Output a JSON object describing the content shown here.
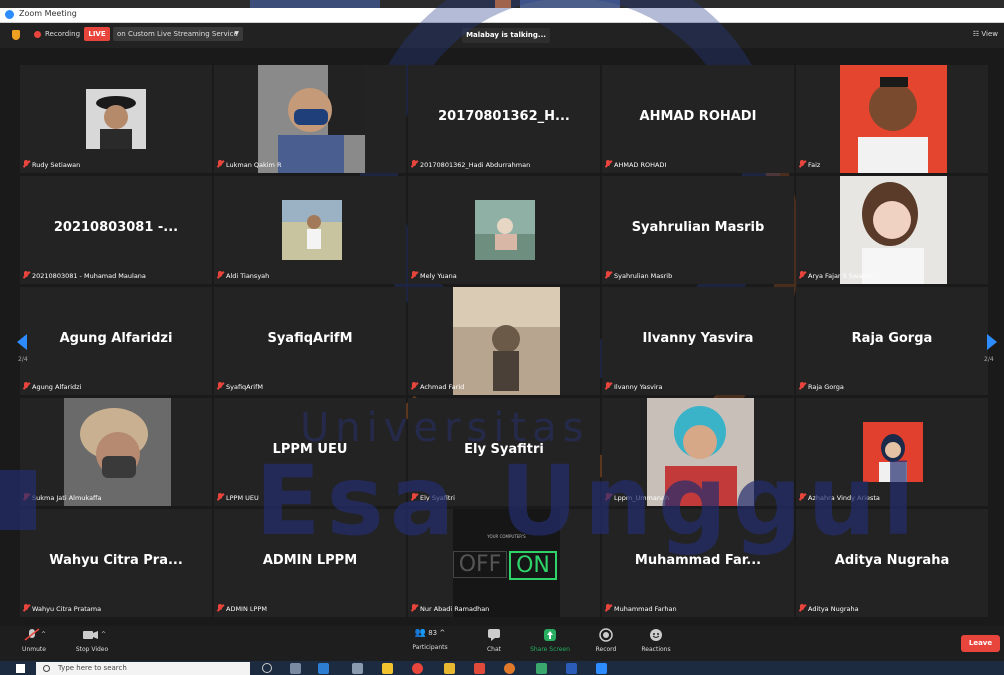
{
  "window": {
    "title": "Zoom Meeting"
  },
  "topbar": {
    "recording_label": "Recording",
    "live_badge": "LIVE",
    "stream_service": "on Custom Live Streaming Service",
    "talking_indicator": "Malabay is talking...",
    "view_label": "View"
  },
  "pagination": {
    "left": "2/4",
    "right": "2/4"
  },
  "tiles": [
    {
      "display": "",
      "label": "Rudy Setiawan"
    },
    {
      "display": "",
      "label": "Lukman Qakim R"
    },
    {
      "display": "20170801362_H...",
      "label": "20170801362_Hadi Abdurrahman"
    },
    {
      "display": "AHMAD ROHADI",
      "label": "AHMAD ROHADI"
    },
    {
      "display": "",
      "label": "Faiz"
    },
    {
      "display": "20210803081 -...",
      "label": "20210803081 - Muhamad Maulana"
    },
    {
      "display": "",
      "label": "Aldi Tiansyah"
    },
    {
      "display": "",
      "label": "Mely Yuana"
    },
    {
      "display": "Syahrulian Masrib",
      "label": "Syahrulian Masrib"
    },
    {
      "display": "",
      "label": "Arya Fajar S Swanto"
    },
    {
      "display": "Agung Alfaridzi",
      "label": "Agung Alfaridzi"
    },
    {
      "display": "SyafiqArifM",
      "label": "SyafiqArifM"
    },
    {
      "display": "",
      "label": "Achmad Farid"
    },
    {
      "display": "Ilvanny Yasvira",
      "label": "Ilvanny Yasvira"
    },
    {
      "display": "Raja Gorga",
      "label": "Raja Gorga"
    },
    {
      "display": "",
      "label": "Sukma Jati Almukaffa"
    },
    {
      "display": "LPPM UEU",
      "label": "LPPM UEU"
    },
    {
      "display": "Ely Syafitri",
      "label": "Ely Syafitri"
    },
    {
      "display": "",
      "label": "Lppm_Ummanah"
    },
    {
      "display": "",
      "label": "Azhahra Vindy Ariesta"
    },
    {
      "display": "Wahyu Citra Pra...",
      "label": "Wahyu Citra Pratama"
    },
    {
      "display": "ADMIN LPPM",
      "label": "ADMIN LPPM"
    },
    {
      "display": "",
      "label": "Nur Abadi Ramadhan"
    },
    {
      "display": "Muhammad  Far...",
      "label": "Muhammad Farhan"
    },
    {
      "display": "Aditya Nugraha",
      "label": "Aditya Nugraha"
    }
  ],
  "sign_video": {
    "caption": "YOUR COMPUTER'S",
    "off": "OFF",
    "on": "ON"
  },
  "watermark": {
    "line1": "Universitas",
    "line2": "Esa Unggul"
  },
  "toolbar": {
    "unmute": "Unmute",
    "stop_video": "Stop Video",
    "participants_count": "83",
    "participants": "Participants",
    "chat": "Chat",
    "share_screen": "Share Screen",
    "record": "Record",
    "reactions": "Reactions",
    "leave": "Leave"
  },
  "taskbar": {
    "search_placeholder": "Type here to search"
  },
  "colors": {
    "accent": "#2d8cff",
    "live_red": "#e8453c",
    "share_green": "#27ae60"
  }
}
